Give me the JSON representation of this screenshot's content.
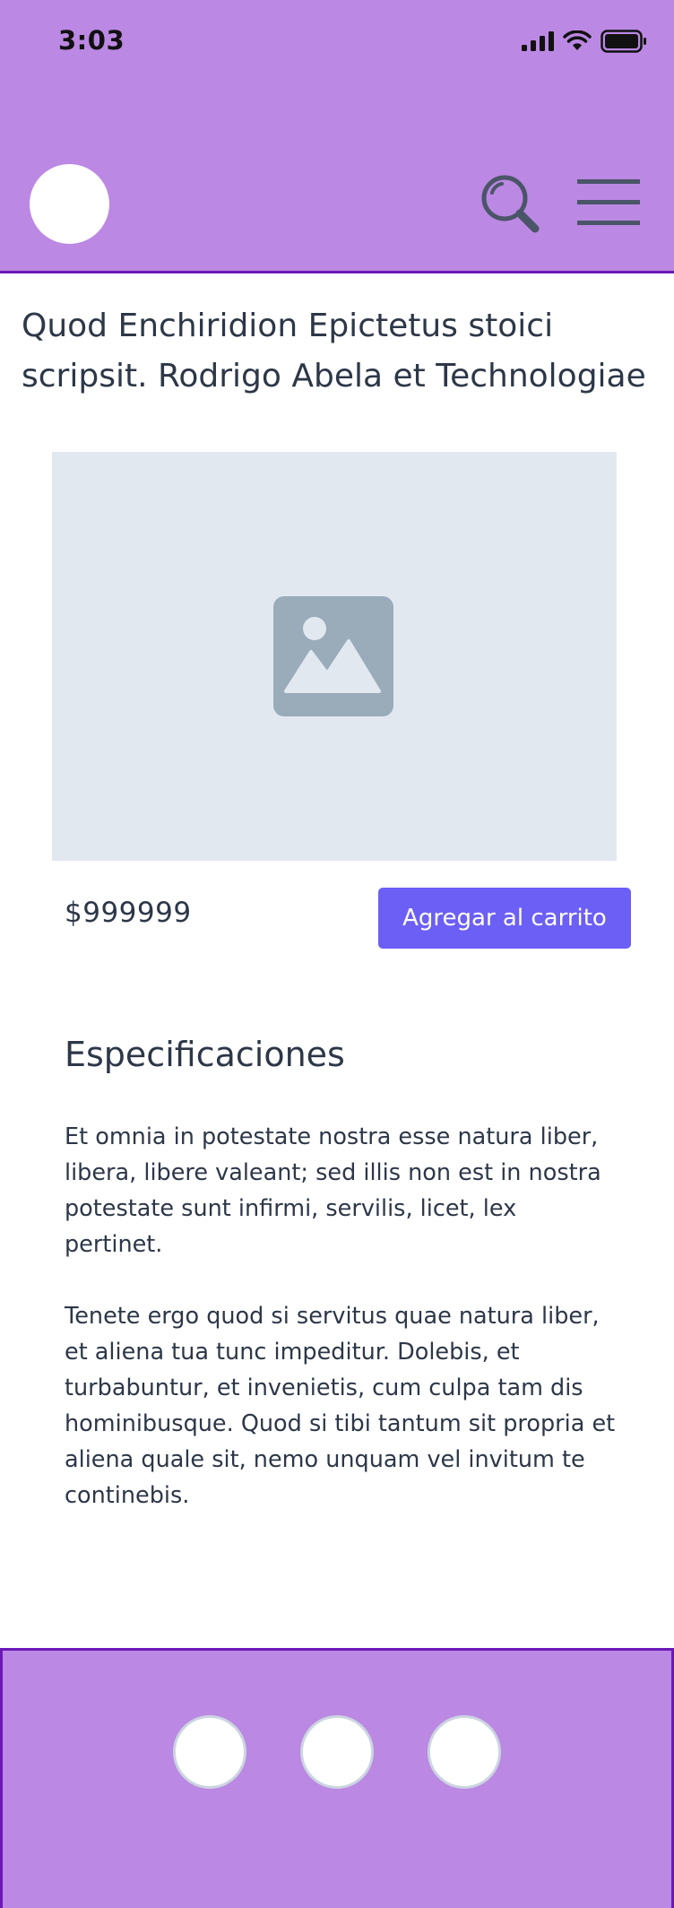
{
  "status_bar": {
    "time": "3:03"
  },
  "header": {
    "logo_icon": "avatar-circle",
    "search_icon": "magnifier-icon",
    "menu_icon": "hamburger-icon"
  },
  "product": {
    "title": "Quod Enchiridion Epictetus stoici scripsit. Rodrigo Abela et Technologiae",
    "image_icon": "image-placeholder-icon",
    "price": "$999999",
    "add_to_cart_label": "Agregar al carrito"
  },
  "specs": {
    "title": "Especificaciones",
    "paragraphs": [
      "Et omnia in potestate nostra esse natura liber, libera, libere valeant; sed illis non est in nostra potestate sunt infirmi, servilis, licet, lex pertinet.",
      "Tenete ergo quod si servitus quae natura liber, et aliena tua tunc impeditur. Dolebis, et turbabuntur, et invenietis, cum culpa tam dis hominibusque. Quod si tibi tantum sit propria et aliena quale sit, nemo unquam vel invitum te continebis."
    ]
  },
  "colors": {
    "header_bg": "#bb88e3",
    "header_border": "#6b18b8",
    "button_bg": "#6c5ff5",
    "placeholder_bg": "#e2e8f0",
    "text": "#2d3748"
  }
}
